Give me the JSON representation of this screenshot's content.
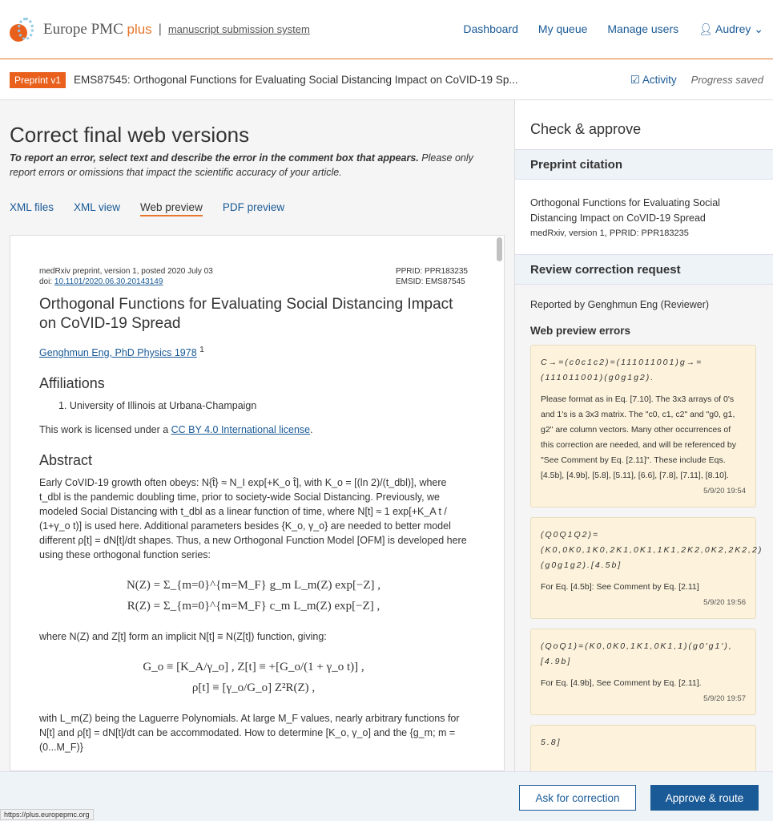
{
  "header": {
    "brand": "Europe PMC",
    "brand_plus": "plus",
    "separator": "|",
    "system": "manuscript submission system",
    "nav": [
      "Dashboard",
      "My queue",
      "Manage users"
    ],
    "user": "Audrey"
  },
  "subheader": {
    "badge": "Preprint v1",
    "title": "EMS87545: Orthogonal Functions for Evaluating Social Distancing Impact on CoVID-19 Sp...",
    "activity": "Activity",
    "status": "Progress saved"
  },
  "main": {
    "title": "Correct final web versions",
    "instructions_bold": "To report an error, select text and describe the error in the comment box that appears.",
    "instructions": " Please only report errors or omissions that impact the scientific accuracy of your article.",
    "tabs": [
      "XML files",
      "XML view",
      "Web preview",
      "PDF preview"
    ],
    "active_tab": "Web preview"
  },
  "doc": {
    "meta_left1": "medRxiv preprint, version 1, posted 2020 July 03",
    "doi_label": "doi: ",
    "doi": "10.1101/2020.06.30.20143149",
    "pprid": "PPRID: PPR183235",
    "emsid": "EMSID: EMS87545",
    "title": "Orthogonal Functions for Evaluating Social Distancing Impact on CoVID-19 Spread",
    "author": "Genghmun Eng, PhD Physics 1978",
    "author_sup": "1",
    "affil_heading": "Affiliations",
    "affil": "1.  University of Illinois at Urbana-Champaign",
    "license_pre": "This work is licensed under a ",
    "license_link": "CC BY 4.0 International license",
    "license_post": ".",
    "abstract_heading": "Abstract",
    "abstract": "Early CoVID-19 growth often obeys: N{t̂} ≈ N_I exp[+K_o t̂], with K_o = [(ln 2)/(t_dbl)], where t_dbl is the pandemic doubling time, prior to society-wide Social Distancing. Previously, we modeled Social Distancing with t_dbl as a linear function of time, where N[t] ≈ 1 exp[+K_A t / (1+γ_o t)] is used here. Additional parameters besides {K_o, γ_o} are needed to better model different ρ[t] = dN[t]/dt shapes. Thus, a new Orthogonal Function Model [OFM] is developed here using these orthogonal function series:",
    "eq1": "N(Z) = Σ_{m=0}^{m=M_F} g_m L_m(Z) exp[−Z] ,",
    "eq2": "R(Z) = Σ_{m=0}^{m=M_F} c_m L_m(Z) exp[−Z] ,",
    "where": "where N(Z) and Z[t] form an implicit N[t] ≡ N(Z[t]) function, giving:",
    "eq3": "G_o ≡ [K_A/γ_o] , Z[t] ≡ +[G_o/(1 + γ_o t)] ,",
    "eq4": "ρ[t] ≡ [γ_o/G_o] Z²R(Z) ,",
    "tail": "with L_m(Z) being the Laguerre Polynomials. At large M_F values, nearly arbitrary functions for N[t] and ρ[t] = dN[t]/dt can be accommodated. How to determine [K_o, γ_o] and the {g_m; m = (0...M_F)}"
  },
  "sidebar": {
    "title": "Check & approve",
    "citation_heading": "Preprint citation",
    "citation": "Orthogonal Functions for Evaluating Social Distancing Impact on CoVID-19 Spread",
    "citation_meta": "medRxiv, version 1, PPRID: PPR183235",
    "review_heading": "Review correction request",
    "reported_by": "Reported by Genghmun Eng (Reviewer)",
    "errors_heading": "Web preview errors",
    "comments": [
      {
        "math": "C→=(c0c1c2)=(111011001)g→=(111011001)(g0g1g2).",
        "text": "Please format as in Eq. [7.10]. The 3x3 arrays of 0's and 1's is a 3x3 matrix. The \"c0, c1, c2\" and \"g0, g1, g2\" are column vectors. Many other occurrences of this correction are needed, and will be referenced by \"See Comment by Eq. [2.11]\". These include Eqs. [4.5b], [4.9b], [5.8], [5.11], [6.6], [7.8], [7.11], [8.10].",
        "time": "5/9/20 19:54"
      },
      {
        "math": "(Q0Q1Q2)=(K0,0K0,1K0,2K1,0K1,1K1,2K2,0K2,2K2,2)(g0g1g2).[4.5b]",
        "text": "For Eq. [4.5b]: See Comment by Eq. [2.11]",
        "time": "5/9/20 19:56"
      },
      {
        "math": "(QoQ1)=(K0,0K0,1K1,0K1,1)(g0′g1′),[4.9b]",
        "text": "For Eq. [4.9b], See Comment by Eq. [2.11].",
        "time": "5/9/20 19:57"
      },
      {
        "math": "5.8]",
        "text": "",
        "time": ""
      }
    ]
  },
  "footer": {
    "ask": "Ask for correction",
    "approve": "Approve & route",
    "status_url": "https://plus.europepmc.org"
  },
  "colors": {
    "accent": "#e8762c",
    "link": "#1a5a96",
    "comment_bg": "#fdf3dc"
  }
}
